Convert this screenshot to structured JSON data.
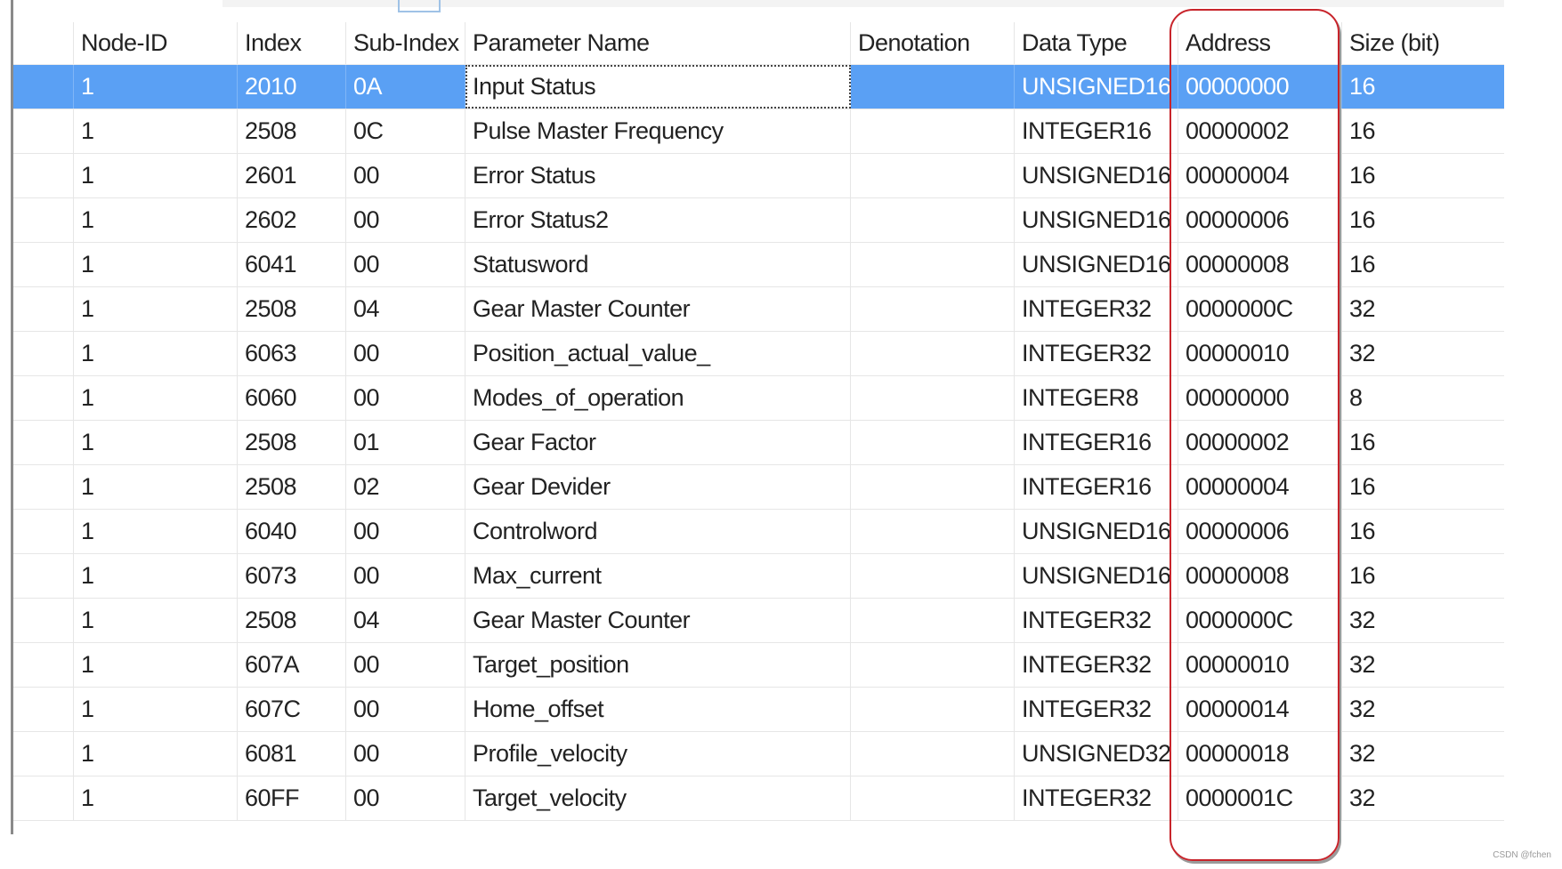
{
  "table": {
    "headers": [
      "",
      "Node-ID",
      "Index",
      "Sub-Index",
      "Parameter Name",
      "Denotation",
      "Data Type",
      "Address",
      "Size (bit)"
    ],
    "rows": [
      [
        "",
        "1",
        "2010",
        "0A",
        "Input Status",
        "",
        "UNSIGNED16",
        "00000000",
        "16"
      ],
      [
        "",
        "1",
        "2508",
        "0C",
        "Pulse Master Frequency",
        "",
        "INTEGER16",
        "00000002",
        "16"
      ],
      [
        "",
        "1",
        "2601",
        "00",
        "Error Status",
        "",
        "UNSIGNED16",
        "00000004",
        "16"
      ],
      [
        "",
        "1",
        "2602",
        "00",
        "Error Status2",
        "",
        "UNSIGNED16",
        "00000006",
        "16"
      ],
      [
        "",
        "1",
        "6041",
        "00",
        "Statusword",
        "",
        "UNSIGNED16",
        "00000008",
        "16"
      ],
      [
        "",
        "1",
        "2508",
        "04",
        "Gear Master Counter",
        "",
        "INTEGER32",
        "0000000C",
        "32"
      ],
      [
        "",
        "1",
        "6063",
        "00",
        "Position_actual_value_",
        "",
        "INTEGER32",
        "00000010",
        "32"
      ],
      [
        "",
        "1",
        "6060",
        "00",
        "Modes_of_operation",
        "",
        "INTEGER8",
        "00000000",
        "8"
      ],
      [
        "",
        "1",
        "2508",
        "01",
        "Gear Factor",
        "",
        "INTEGER16",
        "00000002",
        "16"
      ],
      [
        "",
        "1",
        "2508",
        "02",
        "Gear Devider",
        "",
        "INTEGER16",
        "00000004",
        "16"
      ],
      [
        "",
        "1",
        "6040",
        "00",
        "Controlword",
        "",
        "UNSIGNED16",
        "00000006",
        "16"
      ],
      [
        "",
        "1",
        "6073",
        "00",
        "Max_current",
        "",
        "UNSIGNED16",
        "00000008",
        "16"
      ],
      [
        "",
        "1",
        "2508",
        "04",
        "Gear Master Counter",
        "",
        "INTEGER32",
        "0000000C",
        "32"
      ],
      [
        "",
        "1",
        "607A",
        "00",
        "Target_position",
        "",
        "INTEGER32",
        "00000010",
        "32"
      ],
      [
        "",
        "1",
        "607C",
        "00",
        "Home_offset",
        "",
        "INTEGER32",
        "00000014",
        "32"
      ],
      [
        "",
        "1",
        "6081",
        "00",
        "Profile_velocity",
        "",
        "UNSIGNED32",
        "00000018",
        "32"
      ],
      [
        "",
        "1",
        "60FF",
        "00",
        "Target_velocity",
        "",
        "INTEGER32",
        "0000001C",
        "32"
      ]
    ],
    "selected_row": 0,
    "focus_column": 4
  },
  "highlight": {
    "column": "Address",
    "color": "#c8242b"
  },
  "colors": {
    "selection": "#5aa0f4"
  },
  "watermark": "CSDN @fchen"
}
